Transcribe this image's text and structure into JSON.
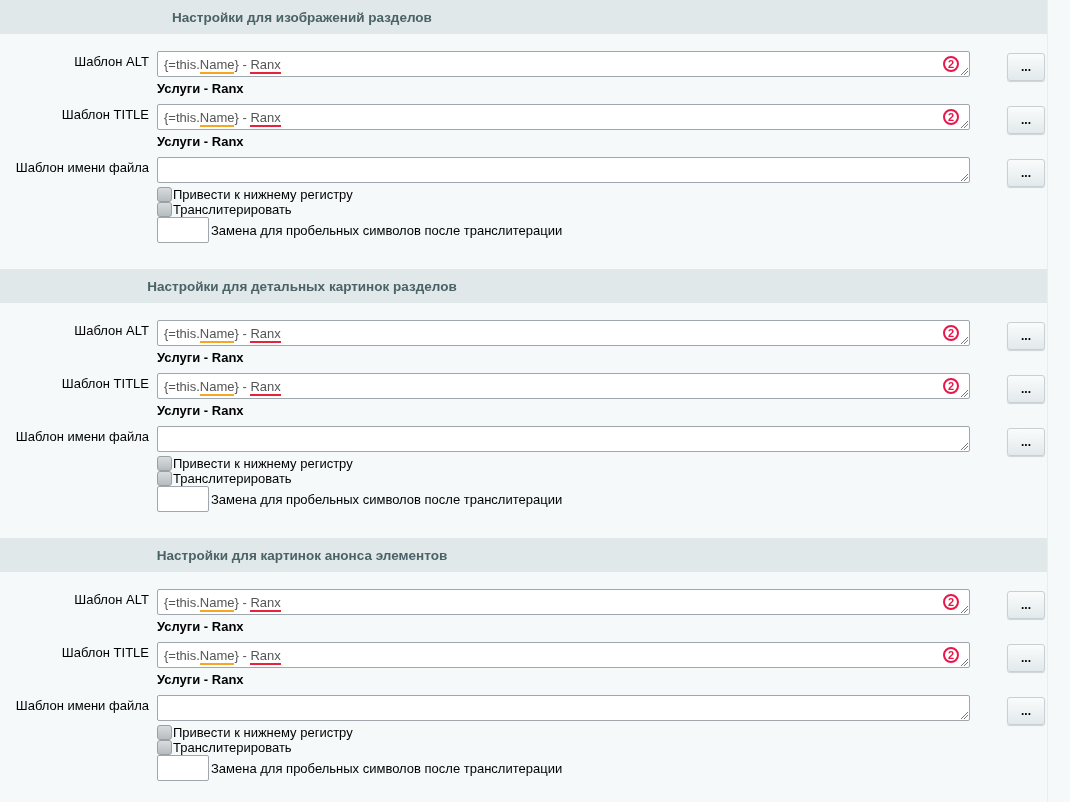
{
  "sections": [
    {
      "title": "Настройки для изображений разделов",
      "templates": [
        {
          "label": "Шаблон ALT",
          "parts": [
            {
              "text": "{=this.",
              "warning": false,
              "error": false
            },
            {
              "text": "Name",
              "warning": true,
              "error": false
            },
            {
              "text": "} - ",
              "warning": false,
              "error": false
            },
            {
              "text": "Ranx",
              "warning": false,
              "error": true
            }
          ],
          "badge": "2",
          "preview": "Услуги - Ranx",
          "button": "..."
        },
        {
          "label": "Шаблон TITLE",
          "parts": [
            {
              "text": "{=this.",
              "warning": false,
              "error": false
            },
            {
              "text": "Name",
              "warning": true,
              "error": false
            },
            {
              "text": "} - ",
              "warning": false,
              "error": false
            },
            {
              "text": "Ranx",
              "warning": false,
              "error": true
            }
          ],
          "badge": "2",
          "preview": "Услуги - Ranx",
          "button": "..."
        }
      ],
      "filename": {
        "label": "Шаблон имени файла",
        "button": "...",
        "options": [
          {
            "label": "Привести к нижнему регистру",
            "checked": false
          },
          {
            "label": "Транслитерировать",
            "checked": false
          }
        ],
        "replace_label": "Замена для пробельных символов после транслитерации"
      }
    },
    {
      "title": "Настройки для детальных картинок разделов",
      "templates": [
        {
          "label": "Шаблон ALT",
          "parts": [
            {
              "text": "{=this.",
              "warning": false,
              "error": false
            },
            {
              "text": "Name",
              "warning": true,
              "error": false
            },
            {
              "text": "} - ",
              "warning": false,
              "error": false
            },
            {
              "text": "Ranx",
              "warning": false,
              "error": true
            }
          ],
          "badge": "2",
          "preview": "Услуги - Ranx",
          "button": "..."
        },
        {
          "label": "Шаблон TITLE",
          "parts": [
            {
              "text": "{=this.",
              "warning": false,
              "error": false
            },
            {
              "text": "Name",
              "warning": true,
              "error": false
            },
            {
              "text": "} - ",
              "warning": false,
              "error": false
            },
            {
              "text": "Ranx",
              "warning": false,
              "error": true
            }
          ],
          "badge": "2",
          "preview": "Услуги - Ranx",
          "button": "..."
        }
      ],
      "filename": {
        "label": "Шаблон имени файла",
        "button": "...",
        "options": [
          {
            "label": "Привести к нижнему регистру",
            "checked": false
          },
          {
            "label": "Транслитерировать",
            "checked": false
          }
        ],
        "replace_label": "Замена для пробельных символов после транслитерации"
      }
    },
    {
      "title": "Настройки для картинок анонса элементов",
      "templates": [
        {
          "label": "Шаблон ALT",
          "parts": [
            {
              "text": "{=this.",
              "warning": false,
              "error": false
            },
            {
              "text": "Name",
              "warning": true,
              "error": false
            },
            {
              "text": "} - ",
              "warning": false,
              "error": false
            },
            {
              "text": "Ranx",
              "warning": false,
              "error": true
            }
          ],
          "badge": "2",
          "preview": "Услуги - Ranx",
          "button": "..."
        },
        {
          "label": "Шаблон TITLE",
          "parts": [
            {
              "text": "{=this.",
              "warning": false,
              "error": false
            },
            {
              "text": "Name",
              "warning": true,
              "error": false
            },
            {
              "text": "} - ",
              "warning": false,
              "error": false
            },
            {
              "text": "Ranx",
              "warning": false,
              "error": true
            }
          ],
          "badge": "2",
          "preview": "Услуги - Ranx",
          "button": "..."
        }
      ],
      "filename": {
        "label": "Шаблон имени файла",
        "button": "...",
        "options": [
          {
            "label": "Привести к нижнему регистру",
            "checked": false
          },
          {
            "label": "Транслитерировать",
            "checked": false
          }
        ],
        "replace_label": "Замена для пробельных символов после транслитерации"
      }
    }
  ]
}
